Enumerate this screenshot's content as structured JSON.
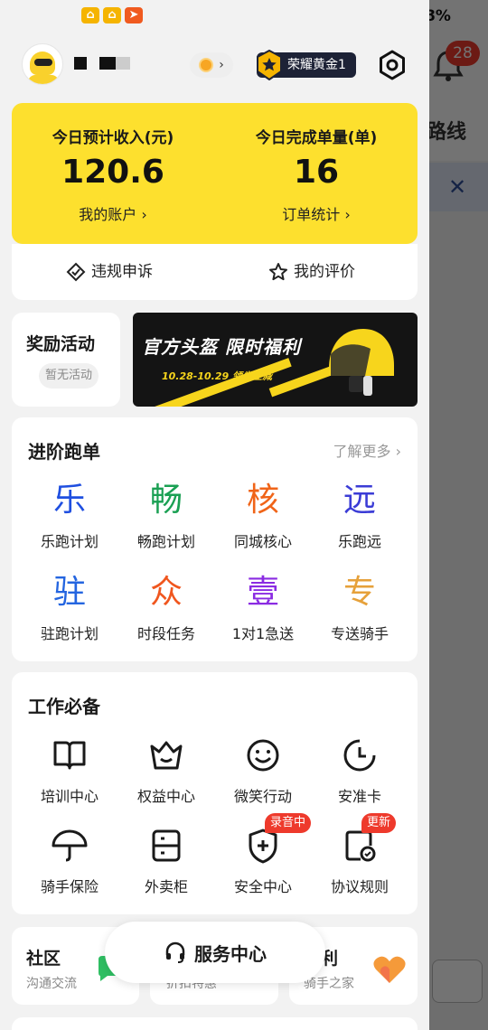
{
  "status_bar": {
    "battery_pct": "8%"
  },
  "background_app": {
    "notification_count": "28",
    "route_text": "路线"
  },
  "header": {
    "rank_label": "荣耀黄金1"
  },
  "income": {
    "today_income_label": "今日预计收入(元)",
    "today_income_value": "120.6",
    "account_link": "我的账户 ›",
    "today_orders_label": "今日完成单量(单)",
    "today_orders_value": "16",
    "order_stats_link": "订单统计 ›"
  },
  "actions": {
    "appeal": "违规申诉",
    "reviews": "我的评价"
  },
  "reward": {
    "title": "奖励活动",
    "chip": "暂无活动"
  },
  "banner": {
    "headline": "官方头盔 限时福利",
    "date": "10.28-10.29 领券立减"
  },
  "advanced": {
    "title": "进阶跑单",
    "more": "了解更多 ›",
    "items": [
      {
        "glyph": "乐",
        "label": "乐跑计划",
        "color": "#1f4fe0"
      },
      {
        "glyph": "畅",
        "label": "畅跑计划",
        "color": "#1aa053"
      },
      {
        "glyph": "核",
        "label": "同城核心",
        "color": "#f06418"
      },
      {
        "glyph": "远",
        "label": "乐跑远",
        "color": "#3b3cd6"
      },
      {
        "glyph": "驻",
        "label": "驻跑计划",
        "color": "#2465e0"
      },
      {
        "glyph": "众",
        "label": "时段任务",
        "color": "#f0561e"
      },
      {
        "glyph": "壹",
        "label": "1对1急送",
        "color": "#8a2be2"
      },
      {
        "glyph": "专",
        "label": "专送骑手",
        "color": "#e6a13a"
      }
    ]
  },
  "work": {
    "title": "工作必备",
    "items": [
      {
        "label": "培训中心",
        "icon": "book-icon"
      },
      {
        "label": "权益中心",
        "icon": "crown-icon"
      },
      {
        "label": "微笑行动",
        "icon": "smile-icon"
      },
      {
        "label": "安准卡",
        "icon": "clock-card-icon"
      },
      {
        "label": "骑手保险",
        "icon": "umbrella-icon"
      },
      {
        "label": "外卖柜",
        "icon": "locker-icon"
      },
      {
        "label": "安全中心",
        "icon": "shield-icon",
        "tag": "录音中"
      },
      {
        "label": "协议规则",
        "icon": "agreement-icon",
        "tag": "更新"
      }
    ]
  },
  "bottom": {
    "community_title": "社区",
    "community_sub": "沟通交流",
    "middle_sub": "折扣特惠",
    "welfare_title": "福利",
    "welfare_sub": "骑手之家",
    "service_center": "服务中心"
  }
}
